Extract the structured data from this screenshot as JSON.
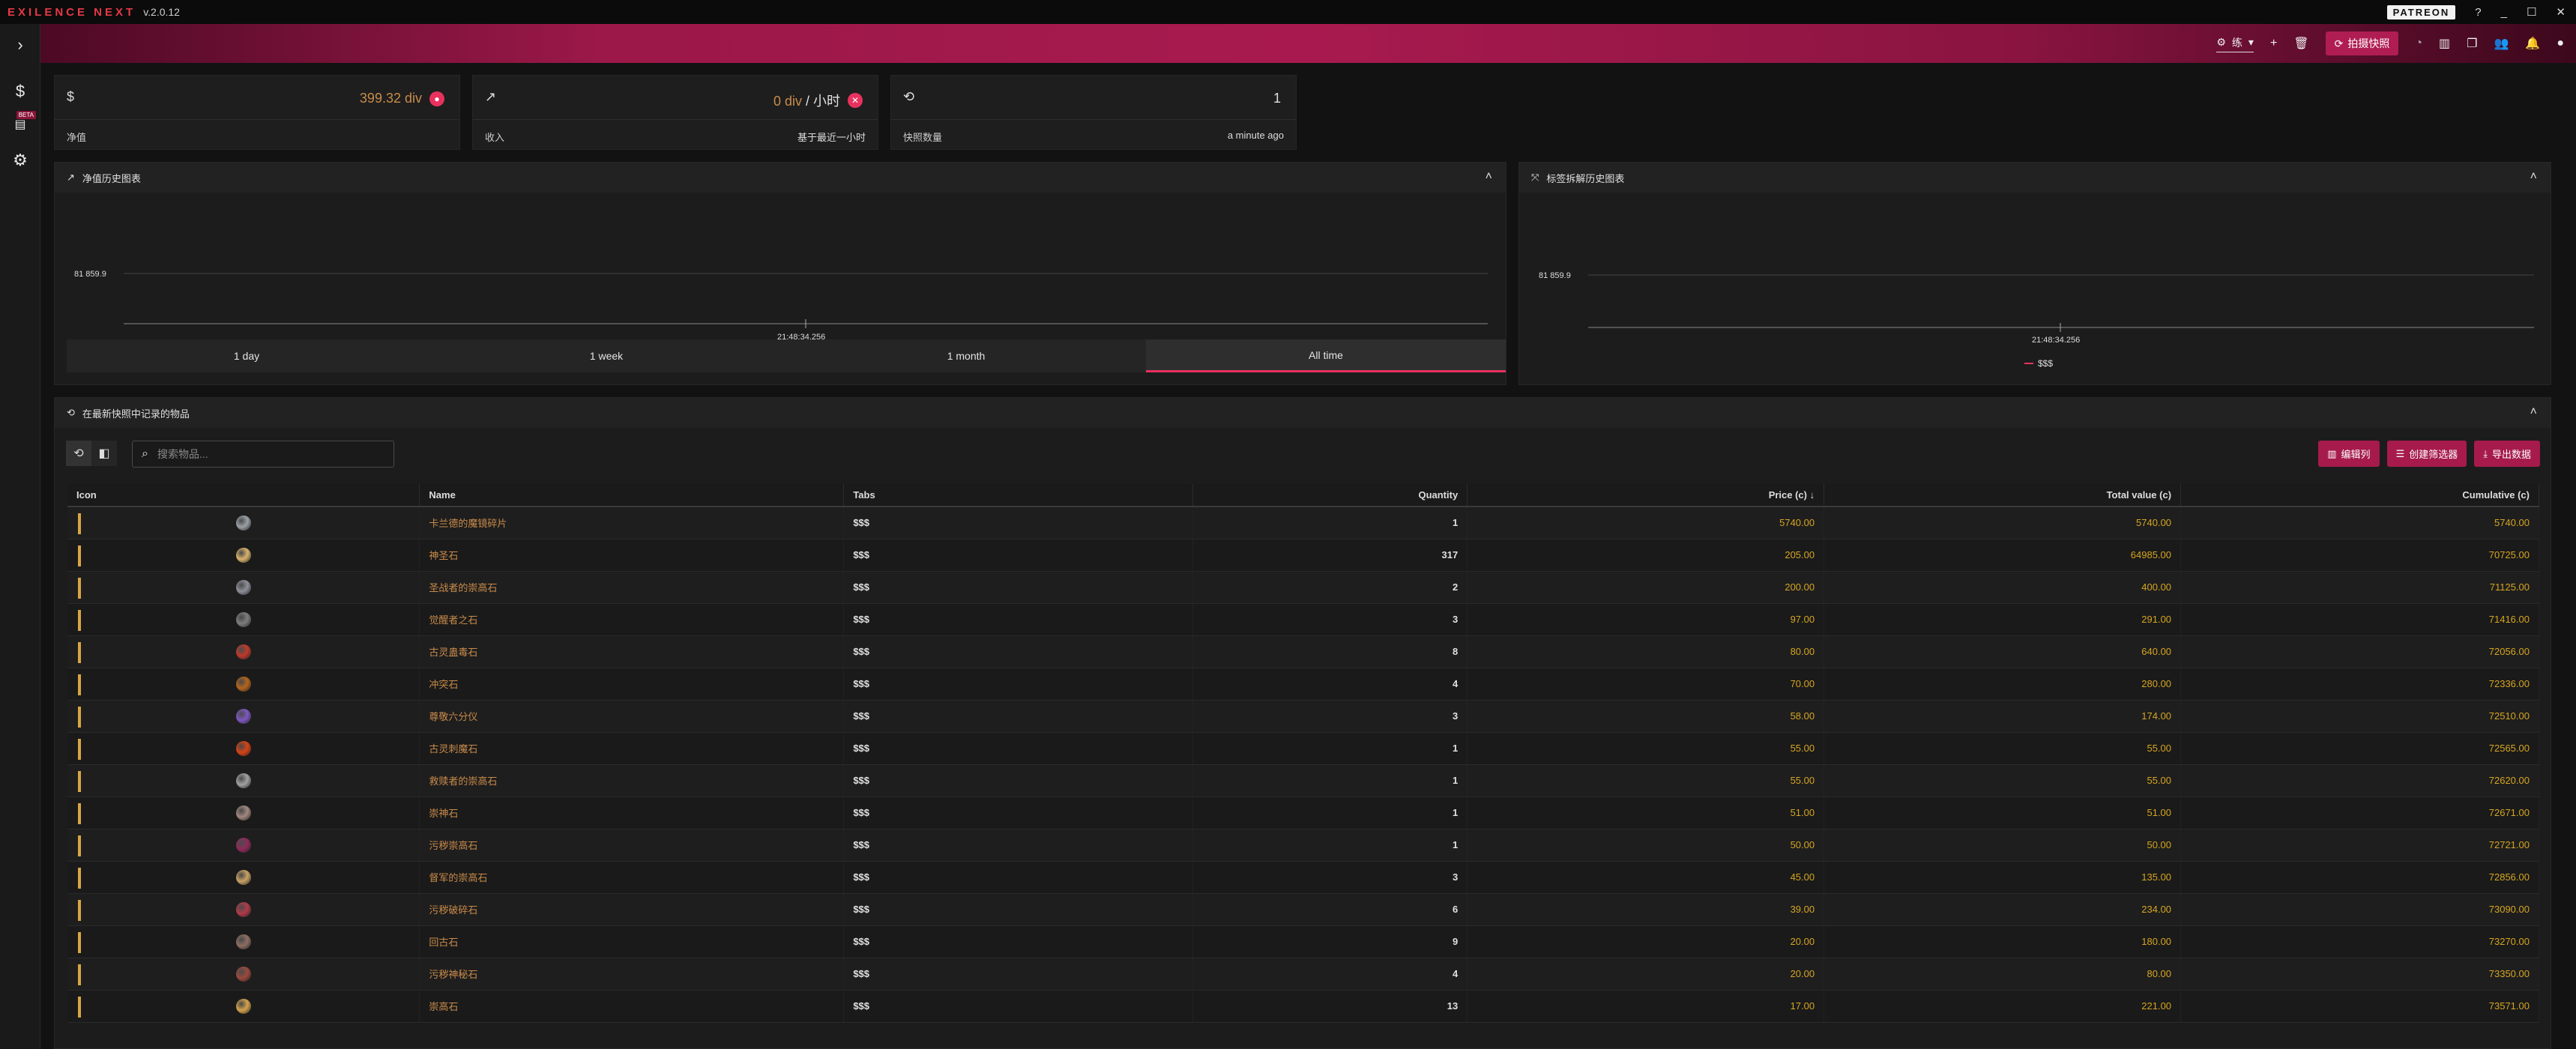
{
  "app": {
    "brand": "EXILENCE NEXT",
    "version": "v.2.0.12",
    "patreon": "PATREON"
  },
  "topbar": {
    "league_value": "练",
    "snapshot_label": "拍摄快照"
  },
  "cards": [
    {
      "value": "399.32 div",
      "label": "净值",
      "sub": ""
    },
    {
      "value": "0 div",
      "unit": "/ 小时",
      "label": "收入",
      "sub": "基于最近一小时"
    },
    {
      "value": "1",
      "label": "快照数量",
      "sub": "a minute ago"
    }
  ],
  "net_chart": {
    "title": "净值历史图表",
    "y_label": "81 859.9",
    "x_label": "21:48:34.256",
    "time_ranges": [
      "1 day",
      "1 week",
      "1 month",
      "All time"
    ],
    "active_range": "All time"
  },
  "tab_chart": {
    "title": "标签拆解历史图表",
    "y_label": "81 859.9",
    "x_label": "21:48:34.256",
    "legend": "$$$"
  },
  "items_panel": {
    "title": "在最新快照中记录的物品",
    "search_placeholder": "搜索物品...",
    "actions": [
      "编辑列",
      "创建筛选器",
      "导出数据"
    ],
    "columns": [
      "Icon",
      "Name",
      "Tabs",
      "Quantity",
      "Price (c) ↓",
      "Total value (c)",
      "Cumulative (c)"
    ],
    "rows": [
      {
        "icon_color": "#9aa0a6",
        "name": "卡兰德的魔镜碎片",
        "tab": "$$$",
        "qty": "1",
        "price": "5740.00",
        "total": "5740.00",
        "cum": "5740.00"
      },
      {
        "icon_color": "#d9b26b",
        "name": "神圣石",
        "tab": "$$$",
        "qty": "317",
        "price": "205.00",
        "total": "64985.00",
        "cum": "70725.00"
      },
      {
        "icon_color": "#8d8f99",
        "name": "圣战者的崇高石",
        "tab": "$$$",
        "qty": "2",
        "price": "200.00",
        "total": "400.00",
        "cum": "71125.00"
      },
      {
        "icon_color": "#7d7d7d",
        "name": "觉醒者之石",
        "tab": "$$$",
        "qty": "3",
        "price": "97.00",
        "total": "291.00",
        "cum": "71416.00"
      },
      {
        "icon_color": "#c0392b",
        "name": "古灵蛊毒石",
        "tab": "$$$",
        "qty": "8",
        "price": "80.00",
        "total": "640.00",
        "cum": "72056.00"
      },
      {
        "icon_color": "#b5651d",
        "name": "冲突石",
        "tab": "$$$",
        "qty": "4",
        "price": "70.00",
        "total": "280.00",
        "cum": "72336.00"
      },
      {
        "icon_color": "#7e57c2",
        "name": "尊敬六分仪",
        "tab": "$$$",
        "qty": "3",
        "price": "58.00",
        "total": "174.00",
        "cum": "72510.00"
      },
      {
        "icon_color": "#d84315",
        "name": "古灵刺魔石",
        "tab": "$$$",
        "qty": "1",
        "price": "55.00",
        "total": "55.00",
        "cum": "72565.00"
      },
      {
        "icon_color": "#a0a0a0",
        "name": "救赎者的崇高石",
        "tab": "$$$",
        "qty": "1",
        "price": "55.00",
        "total": "55.00",
        "cum": "72620.00"
      },
      {
        "icon_color": "#a1887f",
        "name": "崇神石",
        "tab": "$$$",
        "qty": "1",
        "price": "51.00",
        "total": "51.00",
        "cum": "72671.00"
      },
      {
        "icon_color": "#8e2a5a",
        "name": "污秽崇高石",
        "tab": "$$$",
        "qty": "1",
        "price": "50.00",
        "total": "50.00",
        "cum": "72721.00"
      },
      {
        "icon_color": "#c8a165",
        "name": "督军的崇高石",
        "tab": "$$$",
        "qty": "3",
        "price": "45.00",
        "total": "135.00",
        "cum": "72856.00"
      },
      {
        "icon_color": "#b23a48",
        "name": "污秽破碎石",
        "tab": "$$$",
        "qty": "6",
        "price": "39.00",
        "total": "234.00",
        "cum": "73090.00"
      },
      {
        "icon_color": "#8d6e63",
        "name": "回古石",
        "tab": "$$$",
        "qty": "9",
        "price": "20.00",
        "total": "180.00",
        "cum": "73270.00"
      },
      {
        "icon_color": "#9c4a3c",
        "name": "污秽神秘石",
        "tab": "$$$",
        "qty": "4",
        "price": "20.00",
        "total": "80.00",
        "cum": "73350.00"
      },
      {
        "icon_color": "#d4a24c",
        "name": "崇高石",
        "tab": "$$$",
        "qty": "13",
        "price": "17.00",
        "total": "221.00",
        "cum": "73571.00"
      }
    ]
  }
}
